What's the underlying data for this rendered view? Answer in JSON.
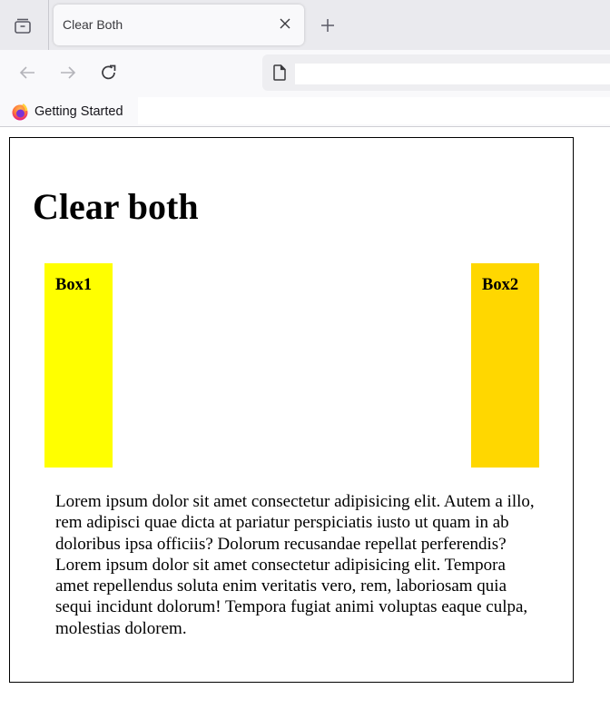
{
  "browser": {
    "tab": {
      "title": "Clear Both",
      "close_icon": "close-icon"
    },
    "new_tab_icon": "plus-icon",
    "tab_list_icon": "tab-list-icon",
    "nav": {
      "back_icon": "arrow-left-icon",
      "forward_icon": "arrow-right-icon",
      "reload_icon": "reload-icon"
    },
    "url": {
      "value": "",
      "page_icon": "page-icon"
    },
    "bookmarks": [
      {
        "label": "Getting Started",
        "icon": "firefox-icon"
      }
    ]
  },
  "page": {
    "heading": "Clear both",
    "boxes": [
      {
        "label": "Box1",
        "color": "#ffff00"
      },
      {
        "label": "Box2",
        "color": "#ffd700"
      }
    ],
    "paragraph": "Lorem ipsum dolor sit amet consectetur adipisicing elit. Autem a illo, rem adipisci quae dicta at pariatur perspiciatis iusto ut quam in ab doloribus ipsa officiis? Dolorum recusandae repellat perferendis? Lorem ipsum dolor sit amet consectetur adipisicing elit. Tempora amet repellendus soluta enim veritatis vero, rem, laboriosam quia sequi incidunt dolorum! Tempora fugiat animi voluptas eaque culpa, molestias dolorem."
  }
}
